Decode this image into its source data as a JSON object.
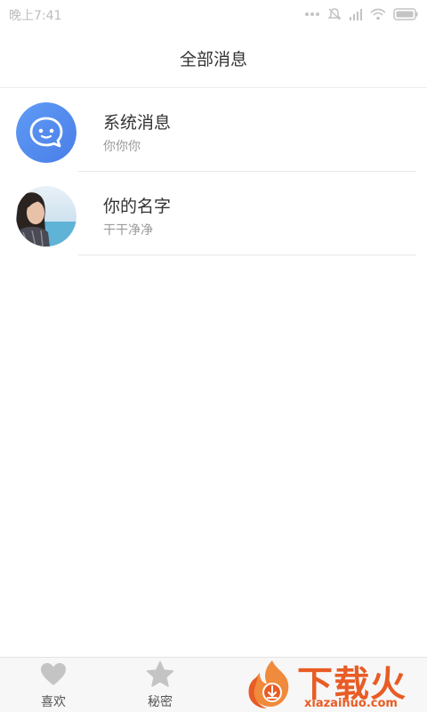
{
  "status_bar": {
    "time": "晚上7:41",
    "icons": [
      "signal-icon",
      "mute-icon",
      "cellular-icon",
      "wifi-icon",
      "battery-icon"
    ]
  },
  "header": {
    "title": "全部消息"
  },
  "messages": [
    {
      "title": "系统消息",
      "subtitle": "你你你",
      "avatar": "system-bot-avatar",
      "avatar_color": "#5b8ef0"
    },
    {
      "title": "你的名字",
      "subtitle": "干干净净",
      "avatar": "user-photo-avatar"
    }
  ],
  "tabs": [
    {
      "label": "喜欢",
      "icon": "heart-icon"
    },
    {
      "label": "秘密",
      "icon": "star-icon"
    }
  ],
  "watermark": {
    "brand": "下载火",
    "url": "xiazaihuo.com",
    "color": "#e85c25"
  },
  "colors": {
    "icon_gray": "#c4c4c4",
    "divider": "#e6e6e6"
  }
}
